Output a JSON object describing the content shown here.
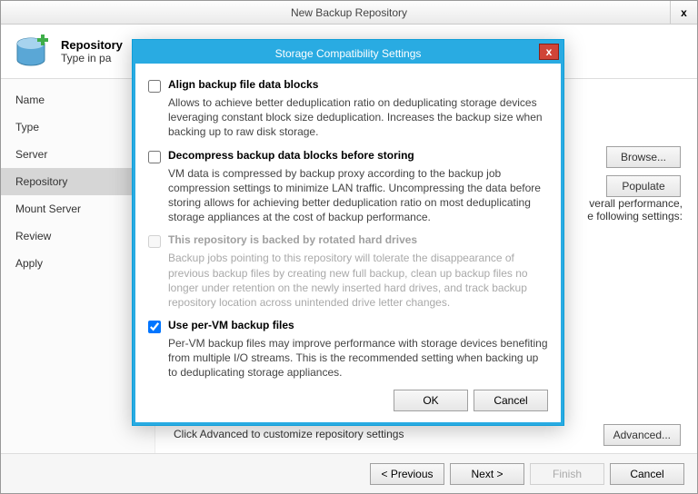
{
  "window": {
    "title": "New Backup Repository"
  },
  "header": {
    "title": "Repository",
    "subtitle": "Type in pa"
  },
  "steps": {
    "name": "Name",
    "type": "Type",
    "server": "Server",
    "repository": "Repository",
    "mount": "Mount Server",
    "review": "Review",
    "apply": "Apply"
  },
  "content": {
    "browse": "Browse...",
    "populate": "Populate",
    "descPart": "verall performance,\n e following settings:",
    "hint": "Click Advanced to customize repository settings",
    "advanced": "Advanced..."
  },
  "footer": {
    "previous": "< Previous",
    "next": "Next >",
    "finish": "Finish",
    "cancel": "Cancel"
  },
  "modal": {
    "title": "Storage Compatibility Settings",
    "closeGlyph": "x",
    "opt1": {
      "label": "Align backup file data blocks",
      "desc": "Allows to achieve better deduplication ratio on deduplicating storage devices leveraging constant block size deduplication. Increases the backup size when backing up to raw disk storage."
    },
    "opt2": {
      "label": "Decompress backup data blocks before storing",
      "desc": "VM data is compressed by backup proxy according to the backup job compression settings to minimize LAN traffic. Uncompressing the data before storing allows for achieving better deduplication ratio on most deduplicating storage appliances at the cost of backup performance."
    },
    "opt3": {
      "label": "This repository is backed by rotated hard drives",
      "desc": "Backup jobs pointing to this repository will tolerate the disappearance of previous backup files by creating new full backup, clean up backup files no longer under retention on the newly inserted hard drives, and track backup repository location across unintended drive letter changes."
    },
    "opt4": {
      "label": "Use per-VM backup files",
      "desc": "Per-VM backup files may improve performance with storage devices benefiting from multiple I/O streams. This is the recommended setting when backing up to deduplicating storage appliances."
    },
    "ok": "OK",
    "cancel": "Cancel"
  }
}
